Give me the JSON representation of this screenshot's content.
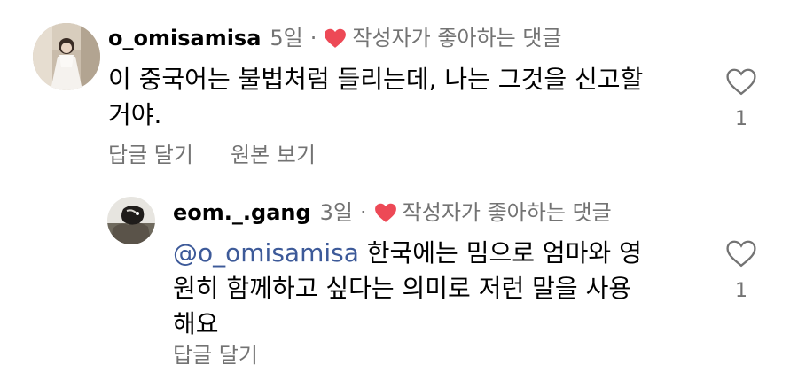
{
  "comments": [
    {
      "username": "o_omisamisa",
      "time": "5일",
      "separator": "·",
      "liked_by_author": "작성자가 좋아하는 댓글",
      "text_line1": "이 중국어는 불법처럼 들리는데, 나는 그것을 신고할",
      "text_line2": "거야.",
      "reply_label": "답글 달기",
      "original_label": "원본 보기",
      "like_count": "1"
    },
    {
      "username": "eom._.gang",
      "time": "3일",
      "separator": "·",
      "liked_by_author": "작성자가 좋아하는 댓글",
      "mention": "@o_omisamisa",
      "text_line1_rest": " 한국에는 밈으로 엄마와 영",
      "text_line2": "원히 함께하고 싶다는 의미로 저런 말을 사용",
      "text_line3": "해요",
      "reply_label": "답글 달기",
      "like_count": "1"
    }
  ],
  "colors": {
    "heart_red": "#ed4956",
    "secondary_text": "#737373",
    "mention_blue": "#3d5a99"
  },
  "icons": {
    "liked_badge": "heart-filled-icon",
    "like_button": "heart-outline-icon"
  }
}
